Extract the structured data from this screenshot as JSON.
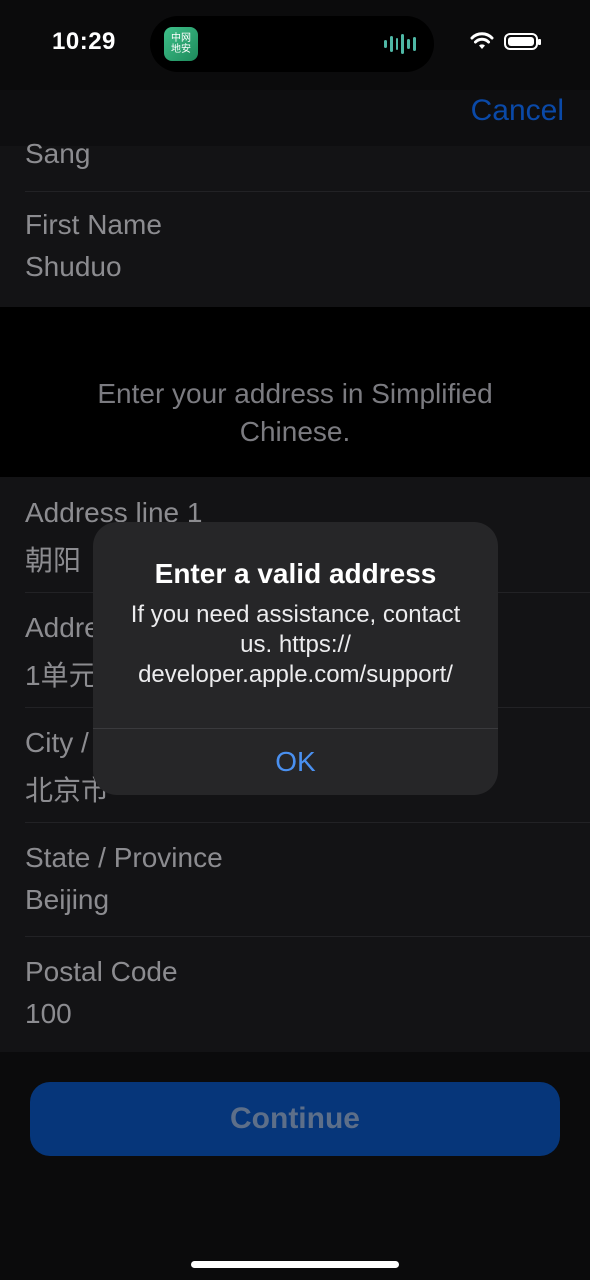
{
  "status_bar": {
    "time": "10:29",
    "app_icon_text": "中网\n地安",
    "icons": [
      "wifi-icon",
      "battery-icon",
      "waveform-icon"
    ]
  },
  "nav": {
    "cancel_label": "Cancel"
  },
  "name_section": {
    "last_name_value": "Sang",
    "first_name_label": "First Name",
    "first_name_value": "Shuduo"
  },
  "notice": "Enter your address in Simplified Chinese.",
  "address_section": {
    "line1_label": "Address line 1",
    "line1_value": "朝阳",
    "line2_label": "Addre",
    "line2_value": "1单元",
    "city_label": "City /",
    "city_value": "北京市",
    "state_label": "State / Province",
    "state_value": "Beijing",
    "postal_label": "Postal Code",
    "postal_value": "100"
  },
  "continue_label": "Continue",
  "alert": {
    "title": "Enter a valid address",
    "message": "If you need assistance, contact us. https:// developer.apple.com/support/",
    "ok_label": "OK"
  },
  "colors": {
    "accent": "#0a49a8",
    "alert_button": "#4a90f0",
    "background": "#0b0b0c"
  }
}
